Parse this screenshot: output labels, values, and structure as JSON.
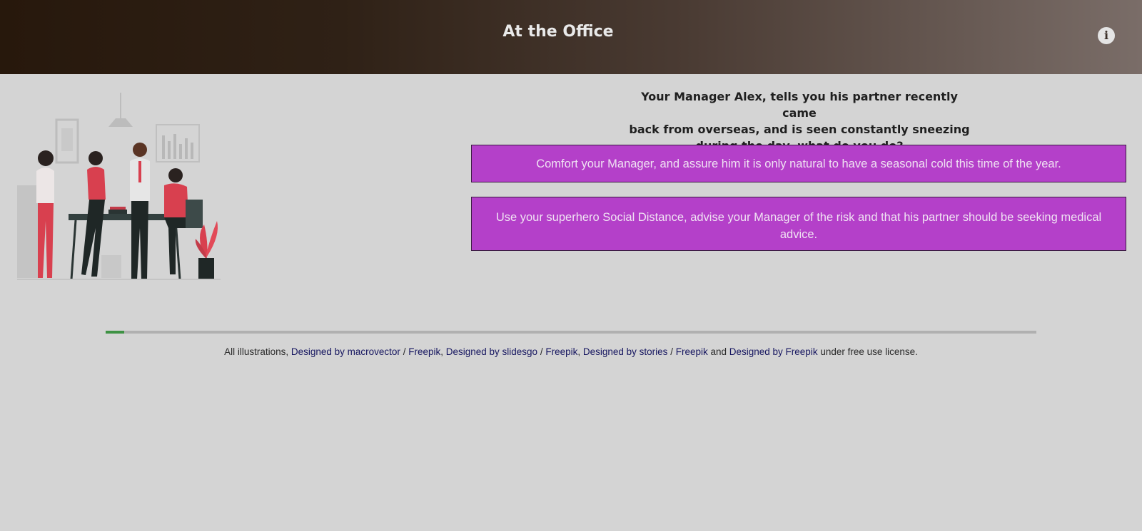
{
  "header": {
    "title": "At the Office",
    "info_icon": "info-icon"
  },
  "question": {
    "line1": "Your Manager Alex, tells you his partner recently came",
    "line2": "back from overseas, and is seen constantly sneezing",
    "line3": "during the day, what do you do?"
  },
  "options": [
    {
      "label": "Comfort your Manager, and assure him it is only natural to have a seasonal cold this time of the year."
    },
    {
      "label": "Use your superhero Social Distance, advise your Manager of the risk and that his partner should be seeking medical advice."
    }
  ],
  "progress": {
    "fraction": 0.02
  },
  "credits": {
    "prefix": "All illustrations, ",
    "link1a": "Designed by macrovector",
    "sep1": " / ",
    "link1b": "Freepik",
    "comma1": ", ",
    "link2a": "Designed by slidesgo",
    "sep2": " / ",
    "link2b": "Freepik",
    "comma2": ", ",
    "link3a": "Designed by stories",
    "sep3": " / ",
    "link3b": "Freepik",
    "and": " and ",
    "link4": "Designed by Freepik",
    "suffix": " under free use license."
  },
  "colors": {
    "option_bg": "#b440c9",
    "progress": "#3e9244",
    "background": "#d4d4d4"
  }
}
